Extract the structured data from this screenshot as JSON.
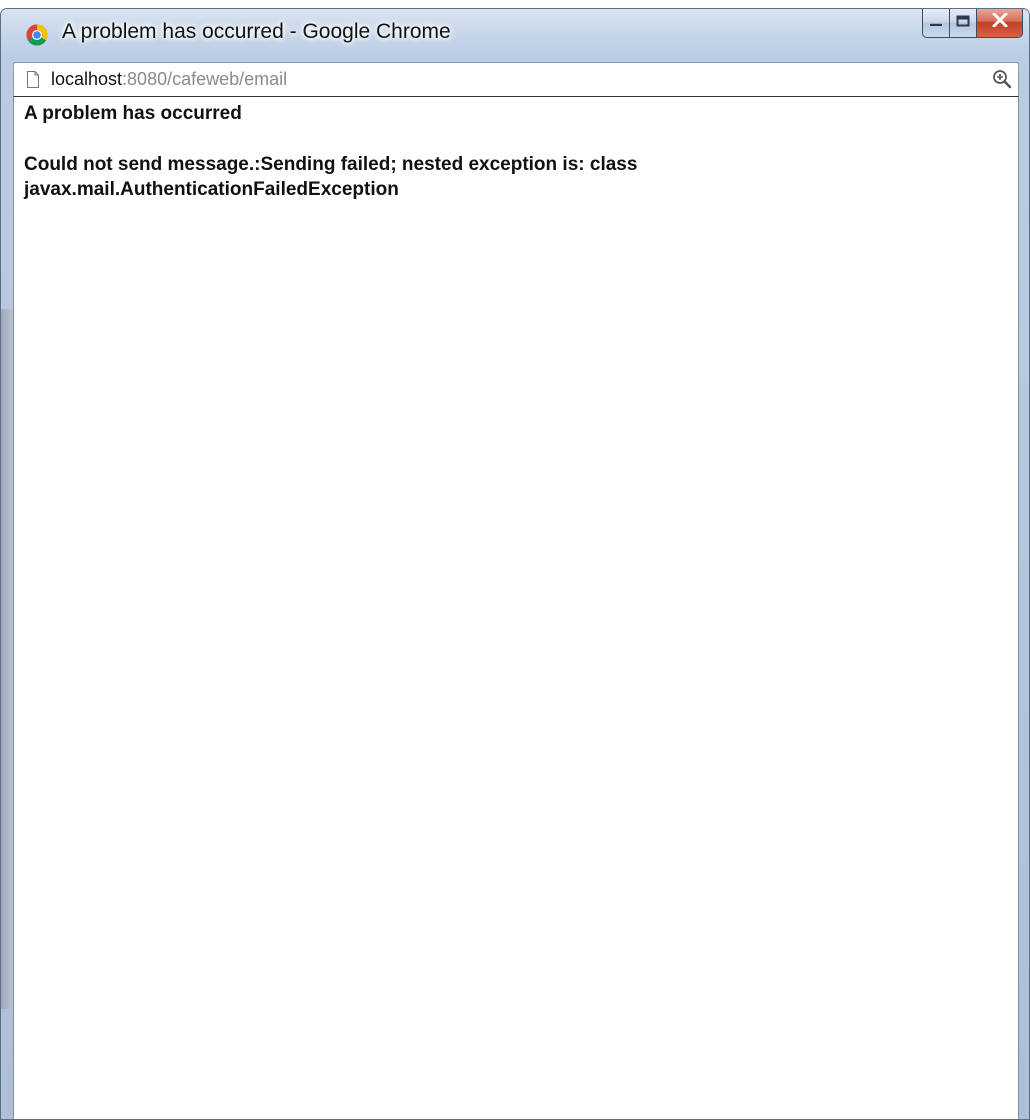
{
  "window": {
    "title": "A problem has occurred - Google Chrome",
    "icon": "chrome-icon"
  },
  "caption_buttons": {
    "minimize_icon": "minimize-icon",
    "maximize_icon": "maximize-icon",
    "close_icon": "close-icon"
  },
  "address_bar": {
    "host": "localhost",
    "path": ":8080/cafeweb/email",
    "page_icon": "page-icon",
    "zoom_icon": "zoom-icon"
  },
  "page": {
    "heading": "A problem has occurred",
    "message": "Could not send message.:Sending failed; nested exception is: class javax.mail.AuthenticationFailedException"
  },
  "colors": {
    "titlebar": "#c8d7ea",
    "close_button": "#c33f25",
    "url_muted": "#8a8a8a"
  }
}
